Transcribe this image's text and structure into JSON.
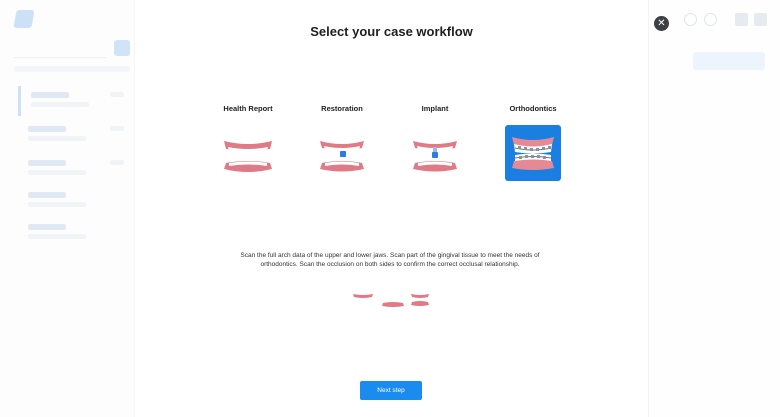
{
  "modal": {
    "title": "Select your case workflow",
    "description": "Scan the full arch data of the upper and lower jaws. Scan part of the gingival tissue to meet the needs of orthodontics. Scan the occlusion on both sides to confirm the correct occlusal relationship.",
    "next_label": "Next step",
    "close_icon": "✕"
  },
  "workflows": [
    {
      "label": "Health Report",
      "icon": "full-arch-teeth-icon",
      "selected": false
    },
    {
      "label": "Restoration",
      "icon": "crown-restoration-icon",
      "selected": false
    },
    {
      "label": "Implant",
      "icon": "implant-icon",
      "selected": false
    },
    {
      "label": "Orthodontics",
      "icon": "braces-icon",
      "selected": true
    }
  ],
  "colors": {
    "accent": "#1a8cf0",
    "selected_tile": "#1a7fe0",
    "gum": "#e07a86"
  }
}
